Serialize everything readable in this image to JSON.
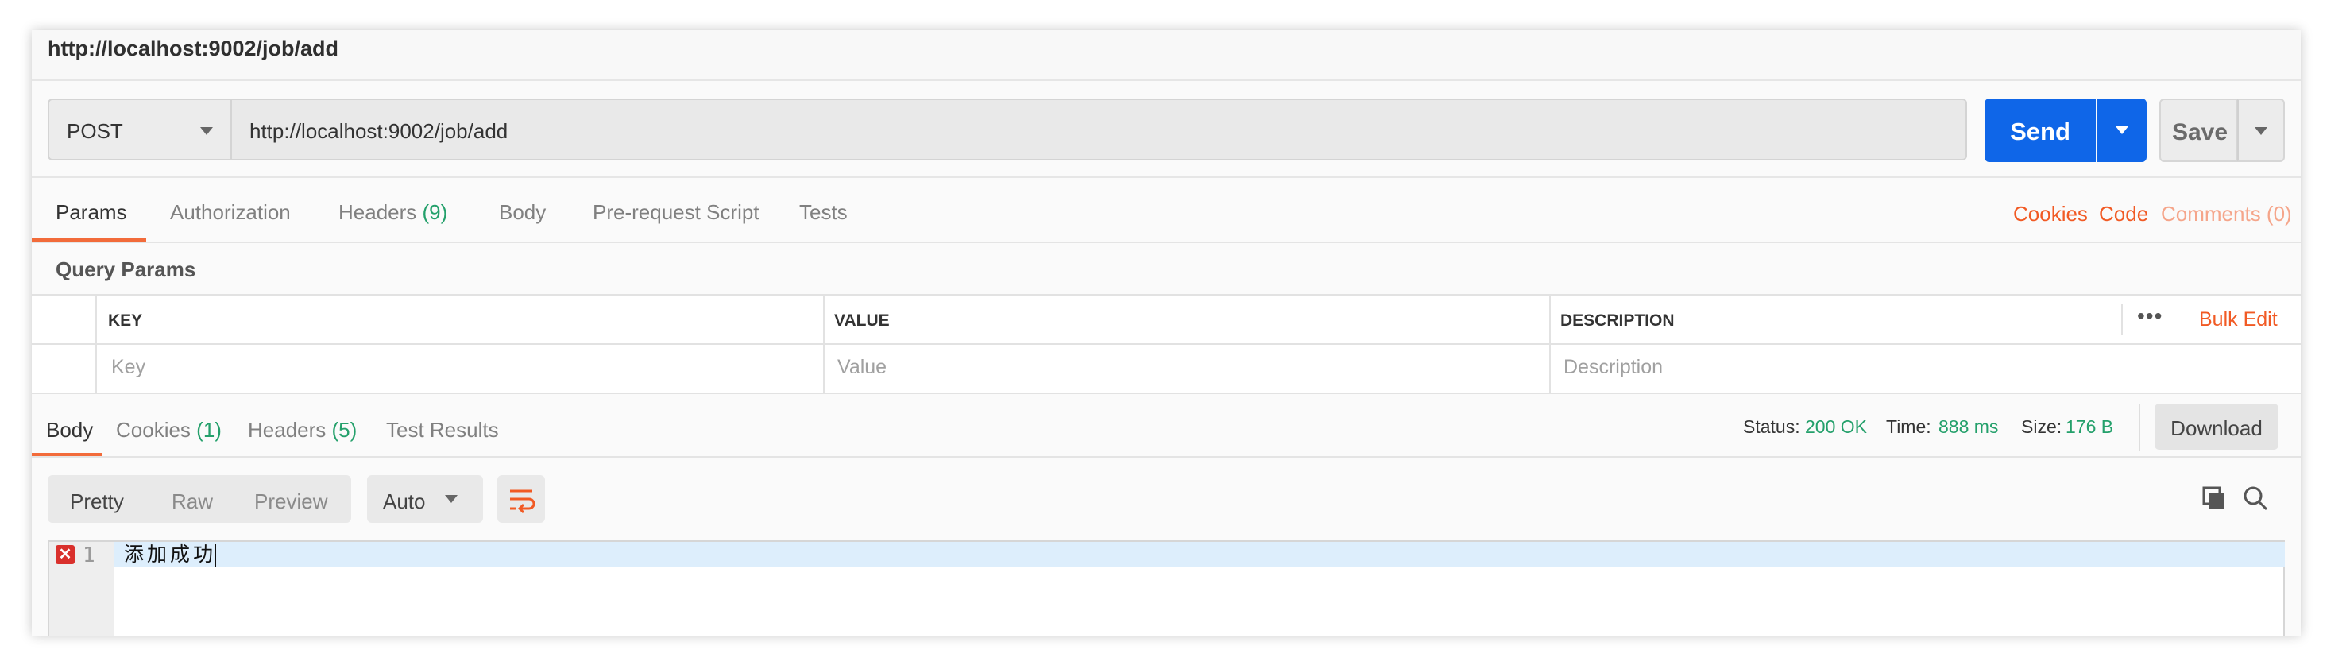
{
  "window": {
    "title": "http://localhost:9002/job/add"
  },
  "request": {
    "method": "POST",
    "url": "http://localhost:9002/job/add",
    "send_label": "Send",
    "save_label": "Save"
  },
  "request_tabs": [
    {
      "label": "Params",
      "active": true
    },
    {
      "label": "Authorization"
    },
    {
      "label": "Headers",
      "count": "(9)"
    },
    {
      "label": "Body"
    },
    {
      "label": "Pre-request Script"
    },
    {
      "label": "Tests"
    }
  ],
  "request_links": {
    "cookies": "Cookies",
    "code": "Code",
    "comments": "Comments (0)"
  },
  "query_params": {
    "title": "Query Params",
    "headers": {
      "key": "KEY",
      "value": "VALUE",
      "description": "DESCRIPTION"
    },
    "more": "•••",
    "bulk_edit": "Bulk Edit",
    "placeholders": {
      "key": "Key",
      "value": "Value",
      "description": "Description"
    }
  },
  "response_tabs": [
    {
      "label": "Body",
      "active": true
    },
    {
      "label": "Cookies",
      "count": "(1)"
    },
    {
      "label": "Headers",
      "count": "(5)"
    },
    {
      "label": "Test Results"
    }
  ],
  "response_meta": {
    "status_label": "Status:",
    "status_value": "200 OK",
    "time_label": "Time:",
    "time_value": "888 ms",
    "size_label": "Size:",
    "size_value": "176 B",
    "download_label": "Download"
  },
  "body_view": {
    "formats": [
      "Pretty",
      "Raw",
      "Preview"
    ],
    "active_format": "Pretty",
    "language": "Auto"
  },
  "code": {
    "line_number": "1",
    "error_marker": "✕",
    "text": "添加成功"
  },
  "colors": {
    "accent": "#f26b3a",
    "primary_button": "#0f66e8",
    "success": "#24a06b",
    "link": "#f15a24"
  },
  "icons": [
    "chevron-down-icon",
    "more-icon",
    "wrap-icon",
    "copy-icon",
    "search-icon",
    "error-icon"
  ]
}
